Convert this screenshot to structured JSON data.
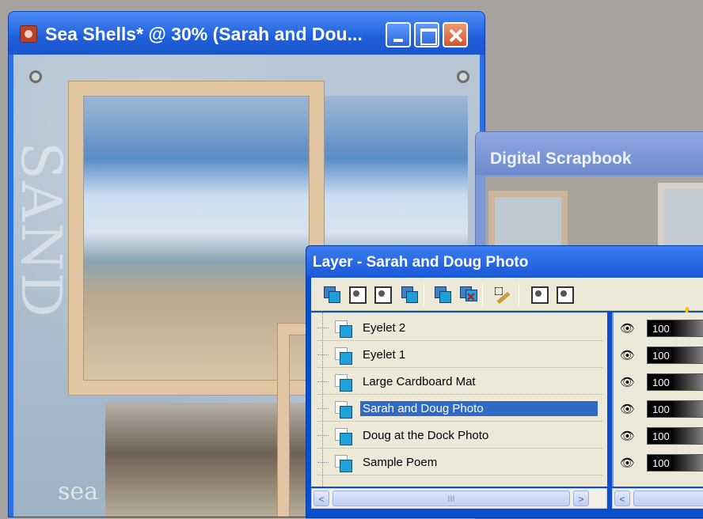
{
  "doc_window": {
    "title": "Sea Shells* @  30% (Sarah and Dou...",
    "canvas_text_vertical": "SAND",
    "canvas_text_bottom": "sea"
  },
  "scrapbook_window": {
    "title": "Digital Scrapbook"
  },
  "layer_palette": {
    "title": "Layer - Sarah and Doug Photo",
    "toolbar": [
      "new-raster-layer-icon",
      "new-vector-layer-icon",
      "new-mask-layer-icon",
      "new-adjustment-layer-icon",
      "duplicate-layer-icon",
      "delete-layer-icon",
      "edit-selection-icon",
      "load-mask-icon",
      "save-mask-icon",
      "pan-hand-icon"
    ],
    "layers": [
      {
        "name": "Eyelet 2",
        "opacity": "100",
        "selected": false
      },
      {
        "name": "Eyelet 1",
        "opacity": "100",
        "selected": false
      },
      {
        "name": "Large Cardboard Mat",
        "opacity": "100",
        "selected": false
      },
      {
        "name": "Sarah and Doug Photo",
        "opacity": "100",
        "selected": true
      },
      {
        "name": "Doug at the Dock Photo",
        "opacity": "100",
        "selected": false
      },
      {
        "name": "Sample Poem",
        "opacity": "100",
        "selected": false
      }
    ],
    "scroll": {
      "left": "<",
      "right": ">",
      "thumb": "III"
    }
  },
  "colors": {
    "xp_blue": "#1f5fdc",
    "selection": "#316ac5",
    "mat": "#e2c6a4"
  }
}
